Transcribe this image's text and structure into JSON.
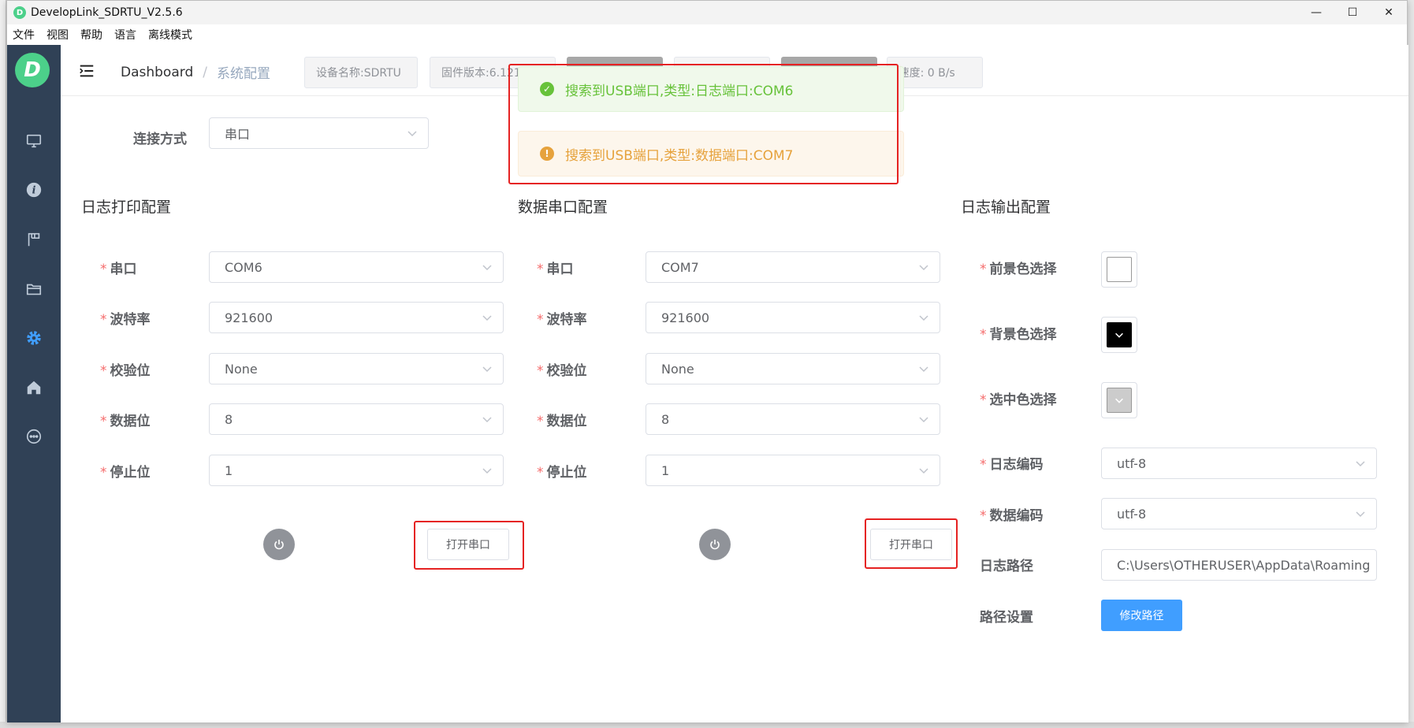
{
  "window": {
    "title": "DevelopLink_SDRTU_V2.5.6",
    "app_icon_letter": "D",
    "minimize": "—",
    "maximize": "☐",
    "close": "✕"
  },
  "menu": [
    "文件",
    "视图",
    "帮助",
    "语言",
    "离线模式"
  ],
  "sidebar": {
    "logo_letter": "D",
    "items": [
      {
        "name": "monitor-icon",
        "active": false
      },
      {
        "name": "info-icon",
        "active": false
      },
      {
        "name": "flag-icon",
        "active": false
      },
      {
        "name": "folder-icon",
        "active": false
      },
      {
        "name": "gear-icon",
        "active": true
      },
      {
        "name": "home-icon",
        "active": false
      },
      {
        "name": "chat-icon",
        "active": false
      }
    ],
    "active_color": "#409eff",
    "icon_color": "#bfcbd9"
  },
  "navbar": {
    "breadcrumb_home": "Dashboard",
    "breadcrumb_sep": "/",
    "breadcrumb_current": "系统配置",
    "tags": [
      "设备名称:SDRTU",
      "固件版本:6.121",
      "",
      "",
      "",
      "X速度: 0 B/s"
    ]
  },
  "notifications": [
    {
      "type": "success",
      "text": "搜索到USB端口,类型:日志端口:COM6"
    },
    {
      "type": "warning",
      "text": "搜索到USB端口,类型:数据端口:COM7"
    }
  ],
  "connection": {
    "label": "连接方式",
    "value": "串口"
  },
  "log_print": {
    "title": "日志打印配置",
    "fields": [
      {
        "label": "串口",
        "value": "COM6"
      },
      {
        "label": "波特率",
        "value": "921600"
      },
      {
        "label": "校验位",
        "value": "None"
      },
      {
        "label": "数据位",
        "value": "8"
      },
      {
        "label": "停止位",
        "value": "1"
      }
    ],
    "open_button": "打开串口"
  },
  "data_serial": {
    "title": "数据串口配置",
    "fields": [
      {
        "label": "串口",
        "value": "COM7"
      },
      {
        "label": "波特率",
        "value": "921600"
      },
      {
        "label": "校验位",
        "value": "None"
      },
      {
        "label": "数据位",
        "value": "8"
      },
      {
        "label": "停止位",
        "value": "1"
      }
    ],
    "open_button": "打开串口"
  },
  "log_output": {
    "title": "日志输出配置",
    "foreground_label": "前景色选择",
    "foreground_color": "#ffffff",
    "background_label": "背景色选择",
    "background_color": "#000000",
    "selected_label": "选中色选择",
    "selected_color": "#cccccc",
    "log_encoding_label": "日志编码",
    "log_encoding_value": "utf-8",
    "data_encoding_label": "数据编码",
    "data_encoding_value": "utf-8",
    "log_path_label": "日志路径",
    "log_path_value": "C:\\Users\\OTHERUSER\\AppData\\Roaming",
    "path_setting_label": "路径设置",
    "modify_path_button": "修改路径"
  },
  "required_mark": "*"
}
